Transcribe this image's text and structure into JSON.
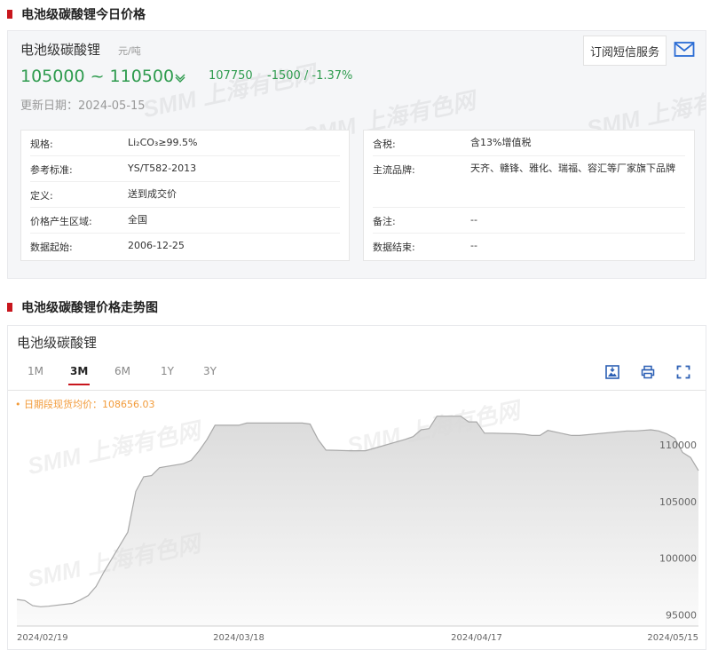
{
  "section1": {
    "title": "电池级碳酸锂今日价格"
  },
  "product": {
    "name": "电池级碳酸锂",
    "unit": "元/吨",
    "price_range": "105000 ~ 110500",
    "avg": "107750",
    "change": "-1500  /  -1.37%",
    "update_date": "更新日期：2024-05-15",
    "subscribe_label": "订阅短信服务",
    "trend_icon": "down-arrow-icon",
    "color_down": "#2e9b4e",
    "accent": "#c8161d"
  },
  "watermark": {
    "text": "SMM 上海有色网"
  },
  "info_left": [
    {
      "label": "规格:",
      "value": "Li₂CO₃≥99.5%"
    },
    {
      "label": "参考标准:",
      "value": "YS/T582-2013"
    },
    {
      "label": "定义:",
      "value": "送到成交价"
    },
    {
      "label": "价格产生区域:",
      "value": "全国"
    },
    {
      "label": "数据起始:",
      "value": "2006-12-25"
    }
  ],
  "info_right": [
    {
      "label": "含税:",
      "value": "含13%增值税"
    },
    {
      "label": "主流品牌:",
      "value": "天齐、赣锋、雅化、瑞福、容汇等厂家旗下品牌"
    },
    {
      "label": "备注:",
      "value": "--"
    },
    {
      "label": "数据结束:",
      "value": "--"
    }
  ],
  "section2": {
    "title": "电池级碳酸锂价格走势图"
  },
  "chart_card": {
    "title": "电池级碳酸锂",
    "tabs": [
      {
        "label": "1M",
        "active": false
      },
      {
        "label": "3M",
        "active": true
      },
      {
        "label": "6M",
        "active": false
      },
      {
        "label": "1Y",
        "active": false
      },
      {
        "label": "3Y",
        "active": false
      }
    ],
    "tools": [
      "download-image-icon",
      "print-icon",
      "fullscreen-icon"
    ],
    "legend_note": "• 日期段现货均价：108656.03"
  },
  "chart_data": {
    "type": "area",
    "title": "",
    "xlabel": "",
    "ylabel": "",
    "ylim": [
      94000,
      113000
    ],
    "yticks": [
      95000,
      100000,
      105000,
      110000
    ],
    "ytick_labels": [
      "95000",
      "100000",
      "105000",
      "110000"
    ],
    "xtick_labels": [
      {
        "date": "2024-02-19",
        "label": "2024/02/19"
      },
      {
        "date": "2024-03-18",
        "label": "2024/03/18"
      },
      {
        "date": "2024-04-17",
        "label": "2024/04/17"
      },
      {
        "date": "2024-05-15",
        "label": "2024/05/15"
      }
    ],
    "grid": false,
    "legend": "none",
    "line_color": "#a8a8a8",
    "fill_color": "#d9d9d9",
    "average": 108656.03,
    "series": [
      {
        "values": [
          [
            "2024-02-19",
            96350
          ],
          [
            "2024-02-20",
            96250
          ],
          [
            "2024-02-21",
            95800
          ],
          [
            "2024-02-22",
            95700
          ],
          [
            "2024-02-23",
            95750
          ],
          [
            "2024-02-26",
            96000
          ],
          [
            "2024-02-27",
            96300
          ],
          [
            "2024-02-28",
            96700
          ],
          [
            "2024-02-29",
            97500
          ],
          [
            "2024-03-01",
            98800
          ],
          [
            "2024-03-04",
            102300
          ],
          [
            "2024-03-05",
            105900
          ],
          [
            "2024-03-06",
            107200
          ],
          [
            "2024-03-07",
            107300
          ],
          [
            "2024-03-08",
            108000
          ],
          [
            "2024-03-11",
            108350
          ],
          [
            "2024-03-12",
            108650
          ],
          [
            "2024-03-13",
            109500
          ],
          [
            "2024-03-14",
            110500
          ],
          [
            "2024-03-15",
            111750
          ],
          [
            "2024-03-18",
            111750
          ],
          [
            "2024-03-19",
            111950
          ],
          [
            "2024-03-20",
            111950
          ],
          [
            "2024-03-21",
            111950
          ],
          [
            "2024-03-22",
            111950
          ],
          [
            "2024-03-25",
            111950
          ],
          [
            "2024-03-26",
            111950
          ],
          [
            "2024-03-27",
            111850
          ],
          [
            "2024-03-28",
            110500
          ],
          [
            "2024-03-29",
            109550
          ],
          [
            "2024-04-01",
            109500
          ],
          [
            "2024-04-02",
            109500
          ],
          [
            "2024-04-03",
            109500
          ],
          [
            "2024-04-08",
            110500
          ],
          [
            "2024-04-09",
            110750
          ],
          [
            "2024-04-10",
            111350
          ],
          [
            "2024-04-11",
            111450
          ],
          [
            "2024-04-12",
            112550
          ],
          [
            "2024-04-15",
            112550
          ],
          [
            "2024-04-16",
            112050
          ],
          [
            "2024-04-17",
            112050
          ],
          [
            "2024-04-18",
            111050
          ],
          [
            "2024-04-19",
            111050
          ],
          [
            "2024-04-22",
            111000
          ],
          [
            "2024-04-23",
            110950
          ],
          [
            "2024-04-24",
            110850
          ],
          [
            "2024-04-25",
            110850
          ],
          [
            "2024-04-26",
            111300
          ],
          [
            "2024-04-29",
            110850
          ],
          [
            "2024-04-30",
            110850
          ],
          [
            "2024-05-06",
            111250
          ],
          [
            "2024-05-07",
            111250
          ],
          [
            "2024-05-08",
            111300
          ],
          [
            "2024-05-09",
            111350
          ],
          [
            "2024-05-10",
            111250
          ],
          [
            "2024-05-11",
            111000
          ],
          [
            "2024-05-12",
            110600
          ],
          [
            "2024-05-13",
            109350
          ],
          [
            "2024-05-14",
            108900
          ],
          [
            "2024-05-15",
            107750
          ]
        ]
      }
    ]
  }
}
